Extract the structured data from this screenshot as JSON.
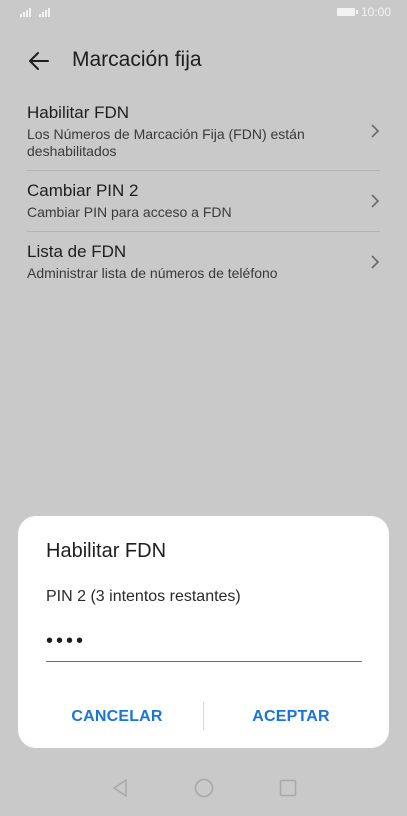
{
  "status_bar": {
    "time": "10:00"
  },
  "header": {
    "title": "Marcación fija"
  },
  "list": [
    {
      "title": "Habilitar FDN",
      "subtitle": "Los Números de Marcación Fija (FDN) están deshabilitados"
    },
    {
      "title": "Cambiar PIN 2",
      "subtitle": "Cambiar PIN para acceso a FDN"
    },
    {
      "title": "Lista de FDN",
      "subtitle": "Administrar lista de números de teléfono"
    }
  ],
  "dialog": {
    "title": "Habilitar FDN",
    "label": "PIN 2 (3 intentos restantes)",
    "pin_value": "••••",
    "cancel_label": "CANCELAR",
    "accept_label": "ACEPTAR"
  },
  "colors": {
    "accent": "#1976d2",
    "dim_background": "#c9c9c9",
    "dialog_background": "#ffffff"
  }
}
